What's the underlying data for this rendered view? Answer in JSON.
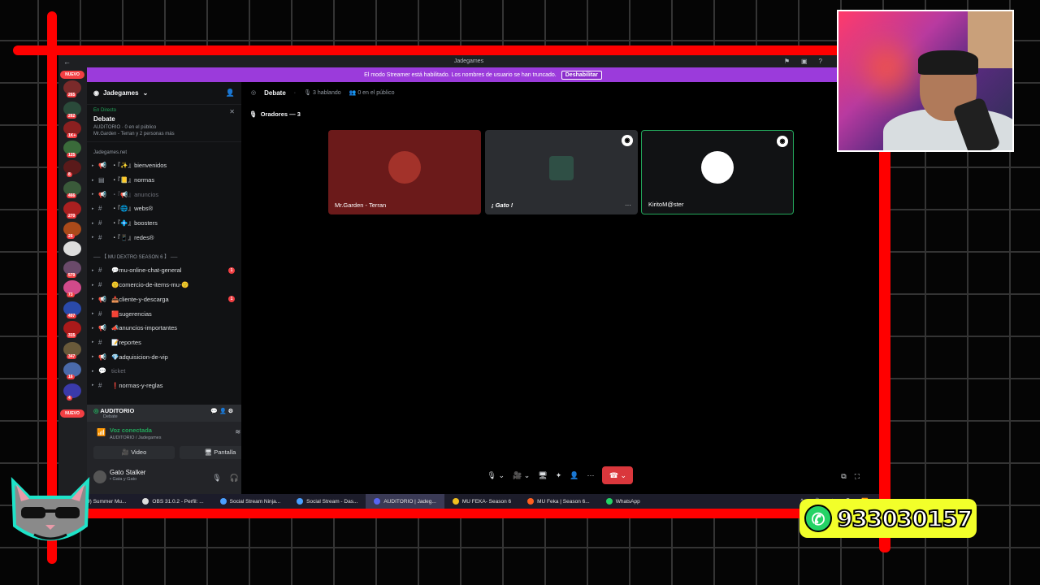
{
  "window": {
    "title": "Jadegames",
    "back": "←"
  },
  "banner": {
    "text": "El modo Streamer está habilitado. Los nombres de usuario se han truncado.",
    "button": "Deshabilitar"
  },
  "servers": {
    "nuevo_top": "NUEVO",
    "nuevo_bottom": "NUEVO",
    "badges": [
      "265",
      "262",
      "1K+",
      "125",
      "8",
      "466",
      "270",
      "26",
      "579",
      "73",
      "497",
      "315",
      "347",
      "16",
      "4"
    ]
  },
  "server_name": "Jadegames",
  "stage": {
    "live_label": "En Directo",
    "title": "Debate",
    "meta": "AUDITORIO · 0 en el público",
    "speakers": "Mr.Garden - Terran y 2 personas más"
  },
  "category1": "Jadegames.net",
  "channels": [
    {
      "icon": "📢",
      "name": "・『✨』bienvenidos",
      "muted": false,
      "badge": ""
    },
    {
      "icon": "▤",
      "name": "・『📒』normas",
      "muted": false,
      "badge": ""
    },
    {
      "icon": "📢",
      "name": "・『📢』anuncios",
      "muted": true,
      "badge": ""
    },
    {
      "icon": "#",
      "name": "・『🌐』webs®",
      "muted": false,
      "badge": ""
    },
    {
      "icon": "#",
      "name": "・『💠』boosters",
      "muted": false,
      "badge": ""
    },
    {
      "icon": "#",
      "name": "・『📱』redes®",
      "muted": false,
      "badge": ""
    }
  ],
  "category2": "── 【 MU DEXTRO SEASON 6 】 ──",
  "channels2": [
    {
      "icon": "#",
      "name": "💬mu-online-chat-general",
      "muted": false,
      "badge": "1"
    },
    {
      "icon": "#",
      "name": "🙂comercio-de-items-mu-🙂",
      "muted": false,
      "badge": ""
    },
    {
      "icon": "📢",
      "name": "📥cliente-y-descarga",
      "muted": false,
      "badge": "1"
    },
    {
      "icon": "#",
      "name": "🟥sugerencias",
      "muted": false,
      "badge": ""
    },
    {
      "icon": "📢",
      "name": "📣anuncios-importantes",
      "muted": false,
      "badge": ""
    },
    {
      "icon": "#",
      "name": "📝reportes",
      "muted": false,
      "badge": ""
    },
    {
      "icon": "📢",
      "name": "💎adquisicion-de-vip",
      "muted": false,
      "badge": ""
    },
    {
      "icon": "💬",
      "name": "ticket",
      "muted": true,
      "badge": ""
    },
    {
      "icon": "#",
      "name": "❗normas-y-reglas",
      "muted": false,
      "badge": ""
    }
  ],
  "voice_channel": {
    "name": "AUDITORIO",
    "sub": "Debate"
  },
  "voice_status": {
    "title": "Voz conectada",
    "sub": "AUDITORIO / Jadegames",
    "video": "Video",
    "screen": "Pantalla"
  },
  "user": {
    "name": "Gato Stalker",
    "status": "• Gata y Gato"
  },
  "main": {
    "title": "Debate",
    "speaking": "3 hablando",
    "audience": "0 en el público",
    "section": "Oradores — 3"
  },
  "tiles": [
    {
      "name": "Mr.Garden - Terran",
      "bg": "#6b1a1a",
      "avatar": "#a3322a"
    },
    {
      "name": "¡ Gato !",
      "bg": "#2b2d31",
      "avatar": "#2f4f45"
    },
    {
      "name": "KiritoM@ster",
      "bg": "#111214",
      "avatar": "#ffffff"
    }
  ],
  "taskbar": [
    {
      "label": "(1849) Summer Mu...",
      "color": "#ff2020"
    },
    {
      "label": "OBS 31.0.2 - Perfil: ...",
      "color": "#dddddd"
    },
    {
      "label": "Social Stream Ninja...",
      "color": "#4aa0ff"
    },
    {
      "label": "Social Stream - Das...",
      "color": "#4aa0ff"
    },
    {
      "label": "AUDITORIO | Jadeg...",
      "color": "#5865f2"
    },
    {
      "label": "MU FEKA- Season 6",
      "color": "#f0c020"
    },
    {
      "label": "MU Feka | Season 6...",
      "color": "#ff6020"
    },
    {
      "label": "WhatsApp",
      "color": "#25d366"
    }
  ],
  "whatsapp": {
    "number": "933030157"
  },
  "colors": {
    "accent": "#9b3bdb",
    "frame": "#ff0000",
    "connected": "#23a55a",
    "hangup": "#da373c"
  }
}
